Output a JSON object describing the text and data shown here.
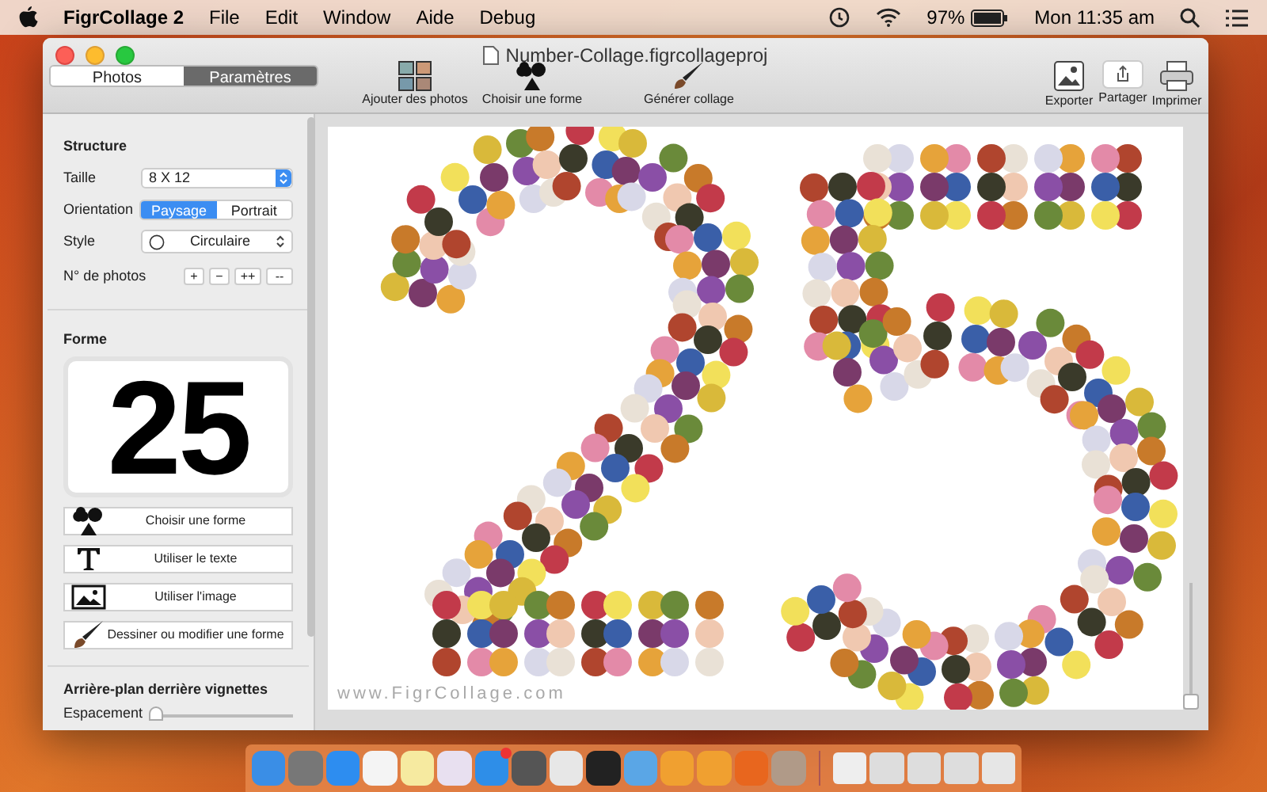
{
  "menubar": {
    "app_name": "FigrCollage 2",
    "menus": [
      "File",
      "Edit",
      "Window",
      "Aide",
      "Debug"
    ],
    "battery": "97%",
    "clock": "Mon 11:35 am"
  },
  "window": {
    "title": "Number-Collage.figrcollageproj",
    "tabs": [
      {
        "label": "Photos",
        "selected": false
      },
      {
        "label": "Paramètres",
        "selected": true
      }
    ],
    "toolbar_center": [
      {
        "kind": "photos",
        "label": "Ajouter des photos"
      },
      {
        "kind": "shapes",
        "label": "Choisir une forme"
      },
      {
        "kind": "brush",
        "label": "Générer collage"
      }
    ],
    "toolbar_right": [
      {
        "kind": "export",
        "label": "Exporter"
      },
      {
        "kind": "share",
        "label": "Partager"
      },
      {
        "kind": "print",
        "label": "Imprimer"
      }
    ]
  },
  "sidebar": {
    "structure": {
      "heading": "Structure",
      "size_label": "Taille",
      "size_value": "8 X 12",
      "orientation_label": "Orientation",
      "orientations": [
        {
          "label": "Paysage",
          "selected": true
        },
        {
          "label": "Portrait",
          "selected": false
        }
      ],
      "style_label": "Style",
      "style_value": "Circulaire",
      "count_label": "N° de photos",
      "count_buttons": [
        "+",
        "−",
        "++",
        "--"
      ]
    },
    "shape": {
      "heading": "Forme",
      "preview_text": "25",
      "buttons": [
        {
          "kind": "shapes",
          "label": "Choisir une forme"
        },
        {
          "kind": "text",
          "label": "Utiliser le texte"
        },
        {
          "kind": "image",
          "label": "Utiliser l'image"
        },
        {
          "kind": "brush",
          "label": "Dessiner ou modifier une forme"
        }
      ]
    },
    "background": {
      "heading": "Arrière-plan derrière vignettes",
      "spacing_label": "Espacement",
      "spacing": {
        "level": 0
      }
    }
  },
  "canvas": {
    "footer": "www.FigrCollage.com",
    "zoom": {
      "level": 0
    }
  }
}
